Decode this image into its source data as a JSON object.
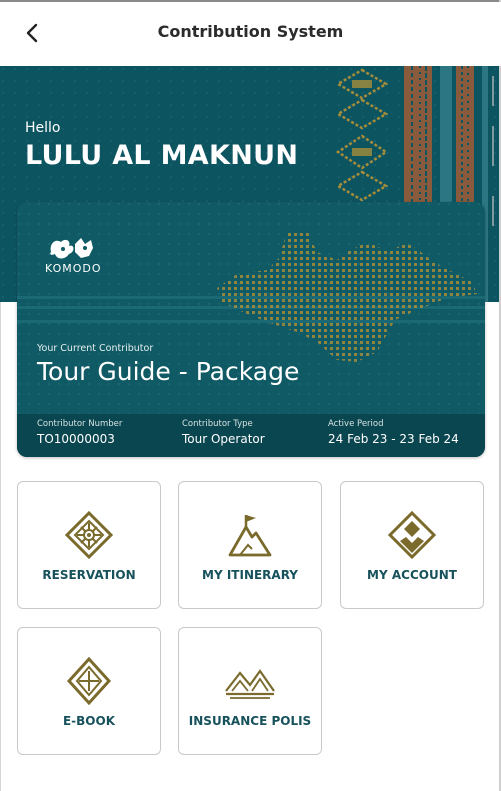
{
  "header": {
    "title": "Contribution System",
    "back_icon": "chevron-left-icon"
  },
  "hero": {
    "greeting": "Hello",
    "name": "LULU AL MAKNUN"
  },
  "card": {
    "logo_text": "KOMODO",
    "current_label": "Your Current Contributor",
    "current_value": "Tour Guide - Package",
    "footer": {
      "number_label": "Contributor Number",
      "number_value": "TO10000003",
      "type_label": "Contributor Type",
      "type_value": "Tour Operator",
      "period_label": "Active Period",
      "period_value": "24 Feb 23 - 23 Feb 24"
    }
  },
  "menu": [
    {
      "label": "RESERVATION",
      "icon": "diamond-sun-icon"
    },
    {
      "label": "MY ITINERARY",
      "icon": "mountain-flag-icon"
    },
    {
      "label": "MY ACCOUNT",
      "icon": "diamond-account-icon"
    },
    {
      "label": "E-BOOK",
      "icon": "diamond-cross-icon"
    },
    {
      "label": "INSURANCE POLIS",
      "icon": "mountains-icon"
    }
  ],
  "colors": {
    "teal": "#0d5461",
    "gold": "#7a6a2c",
    "label_text": "#17525c"
  }
}
